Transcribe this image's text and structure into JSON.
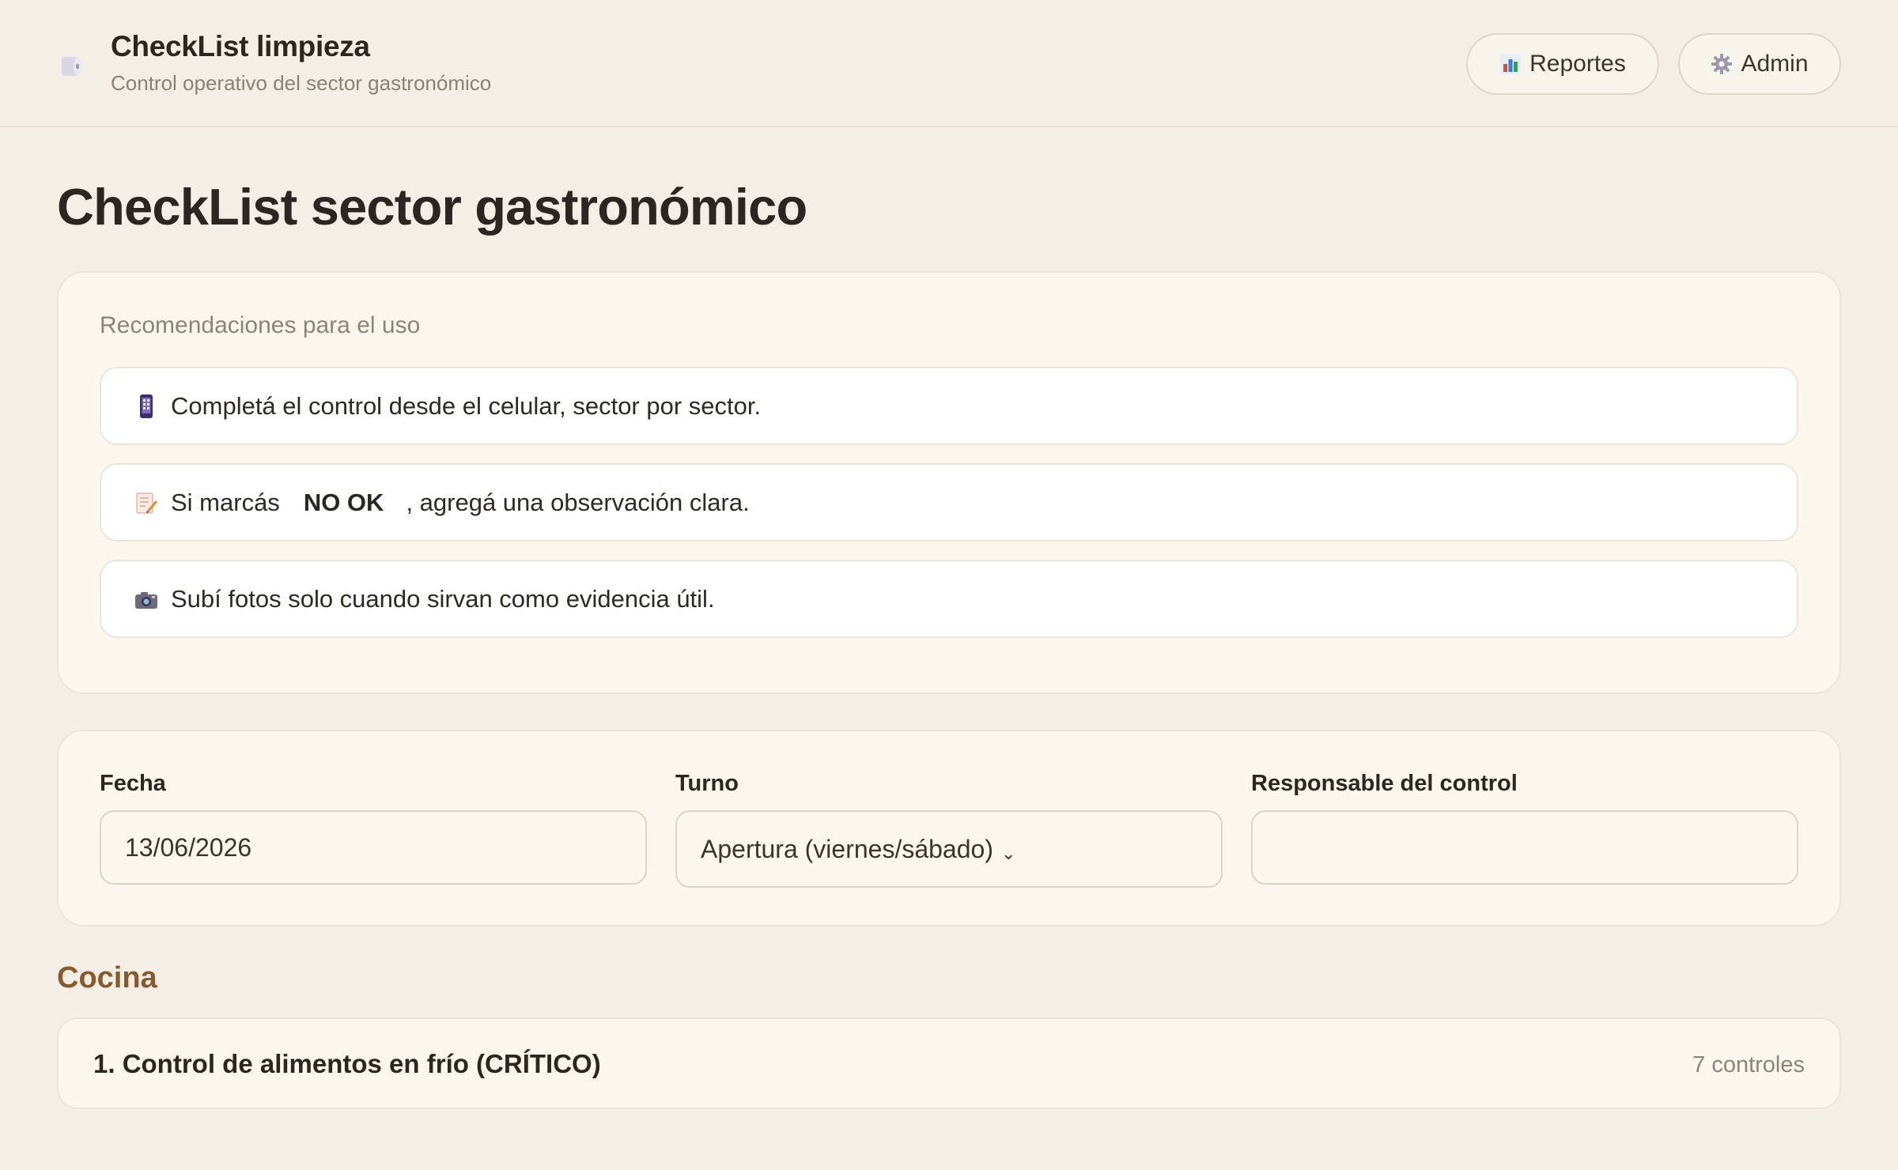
{
  "header": {
    "brand_icon": "toilet-paper-icon",
    "title": "CheckList limpieza",
    "subtitle": "Control operativo del sector gastronómico",
    "buttons": {
      "reportes": {
        "icon": "bar-chart-icon",
        "label": "Reportes"
      },
      "admin": {
        "icon": "gear-icon",
        "label": "Admin"
      }
    }
  },
  "main": {
    "title": "CheckList sector gastronómico",
    "recommendations": {
      "heading": "Recomendaciones para el uso",
      "items": [
        {
          "icon": "mobile-phone-icon",
          "text": "Completá el control desde el celular, sector por sector."
        },
        {
          "icon": "memo-icon",
          "text_before": "Si marcás",
          "highlight": "NO OK",
          "text_after": ", agregá una observación clara."
        },
        {
          "icon": "camera-icon",
          "text": "Subí fotos solo cuando sirvan como evidencia útil."
        }
      ]
    },
    "form": {
      "fecha": {
        "label": "Fecha",
        "value": "13/06/2026"
      },
      "turno": {
        "label": "Turno",
        "value": "Apertura (viernes/sábado)"
      },
      "responsable": {
        "label": "Responsable del control",
        "value": ""
      }
    },
    "sections": [
      {
        "title": "Cocina",
        "groups": [
          {
            "title": "1. Control de alimentos en frío (CRÍTICO)",
            "count": "7 controles"
          }
        ]
      }
    ]
  },
  "colors": {
    "background": "#f3efe7",
    "card": "#faf7ef",
    "section_accent": "#8a5a2b"
  }
}
